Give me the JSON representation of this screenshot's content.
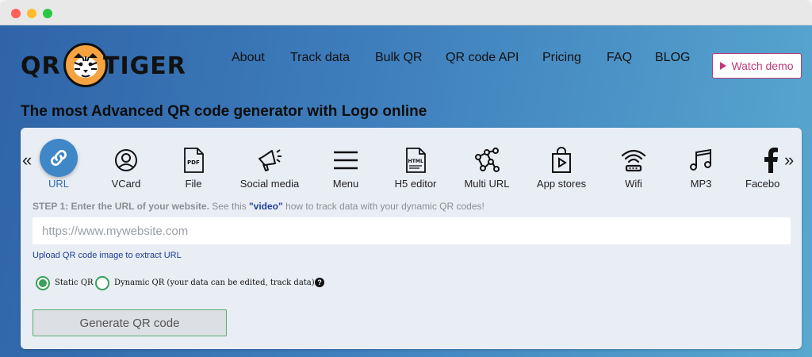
{
  "brand": {
    "logo_left": "QR",
    "logo_right": "TIGER"
  },
  "nav": {
    "items": [
      "About",
      "Track data",
      "Bulk QR",
      "QR code API",
      "Pricing",
      "FAQ",
      "BLOG"
    ],
    "watch_demo": "Watch demo"
  },
  "headline": "The most Advanced QR code generator with Logo online",
  "qr_types": {
    "items": [
      {
        "label": "URL",
        "icon": "link-icon",
        "active": true
      },
      {
        "label": "VCard",
        "icon": "user-circle-icon"
      },
      {
        "label": "File",
        "icon": "pdf-file-icon"
      },
      {
        "label": "Social media",
        "icon": "megaphone-icon"
      },
      {
        "label": "Menu",
        "icon": "menu-icon"
      },
      {
        "label": "H5 editor",
        "icon": "html-file-icon"
      },
      {
        "label": "Multi URL",
        "icon": "network-icon"
      },
      {
        "label": "App stores",
        "icon": "shopping-bag-icon"
      },
      {
        "label": "Wifi",
        "icon": "wifi-icon"
      },
      {
        "label": "MP3",
        "icon": "music-note-icon"
      },
      {
        "label": "Facebo",
        "icon": "facebook-icon"
      }
    ]
  },
  "step": {
    "title": "STEP 1: Enter the URL of your website.",
    "see_this": "See this",
    "video": "\"video\"",
    "rest": "how to track data with your dynamic QR codes!"
  },
  "url_input": {
    "placeholder": "https://www.mywebsite.com",
    "value": ""
  },
  "upload_link": "Upload QR code image to extract URL",
  "qr_mode": {
    "static_label": "Static QR",
    "dynamic_label": "Dynamic QR (your data can be edited, track data)",
    "selected": "static"
  },
  "generate_button": "Generate QR code",
  "colors": {
    "accent": "#3f87c6",
    "demo": "#c0397a",
    "radio": "#3aa05a"
  }
}
